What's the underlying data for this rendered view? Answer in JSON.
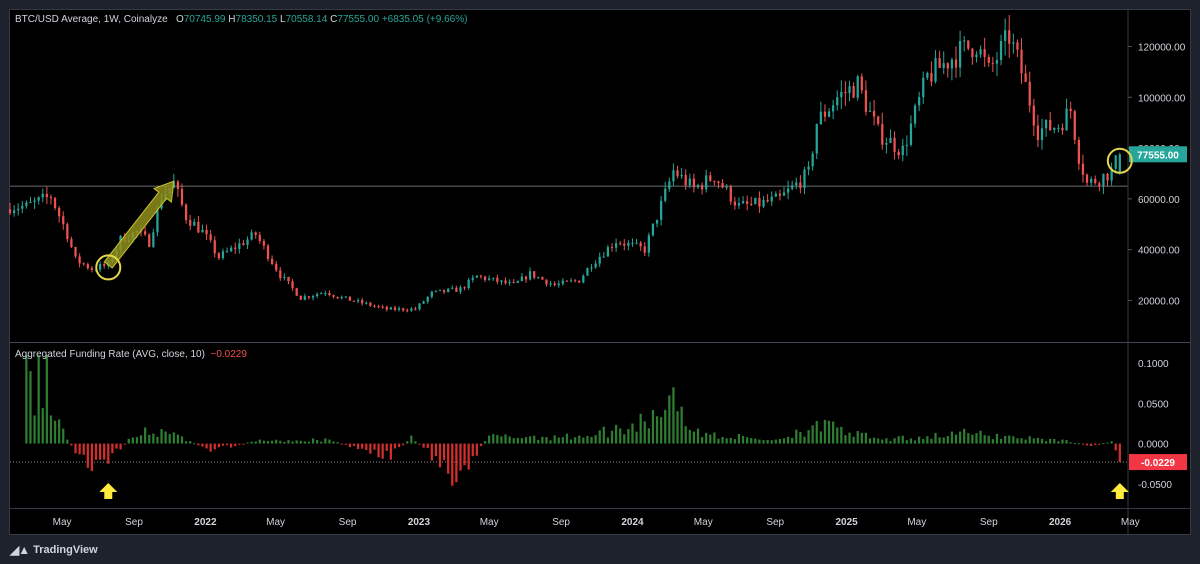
{
  "header": {
    "symbol": "BTC/USD Average, 1W, Coinalyze",
    "o_label": "O",
    "o": "70745.99",
    "h_label": "H",
    "h": "78350.15",
    "l_label": "L",
    "l": "70558.14",
    "c_label": "C",
    "c": "77555.00",
    "change": "+6835.05 (+9.66%)"
  },
  "indicator": {
    "title": "Aggregated Funding Rate (AVG, close, 10)",
    "value": "−0.0229"
  },
  "brand": {
    "name": "TradingView"
  },
  "colors": {
    "up": "#26a69a",
    "down": "#ef5350",
    "fund_up": "#2e7d32",
    "fund_down": "#d32f2f",
    "accent_circle": "#e4d54a",
    "arrow": "#8f8e1c",
    "marker": "#ffeb3b"
  },
  "chart_data": [
    {
      "type": "candlestick",
      "series_name": "BTC/USD Average, 1W, Coinalyze",
      "y_ticks": [
        "120000.00",
        "100000.00",
        "80000.00",
        "60000.00",
        "40000.00",
        "20000.00"
      ],
      "y_tick_values": [
        120000,
        100000,
        80000,
        60000,
        40000,
        20000
      ],
      "ylim": [
        6000,
        132000
      ],
      "last_price_label": "77555.00",
      "last_price": 77555,
      "horizontal_line": 65000,
      "x_ticks": [
        "May",
        "Sep",
        "2022",
        "May",
        "Sep",
        "2023",
        "May",
        "Sep",
        "2024",
        "May",
        "Sep",
        "2025",
        "May",
        "Sep",
        "2026",
        "May"
      ],
      "x_tick_dates": [
        "2021-05-01",
        "2021-09-01",
        "2022-01-01",
        "2022-05-01",
        "2022-09-01",
        "2023-01-01",
        "2023-05-01",
        "2023-09-01",
        "2024-01-01",
        "2024-05-01",
        "2024-09-01",
        "2025-01-01",
        "2025-05-01",
        "2025-09-01",
        "2026-01-01",
        "2026-05-01"
      ],
      "date_range": [
        "2021-03-01",
        "2026-04-13"
      ],
      "closes": [
        [
          "2021-03-01",
          57000
        ],
        [
          "2021-04-12",
          61000
        ],
        [
          "2021-05-10",
          46000
        ],
        [
          "2021-05-24",
          36000
        ],
        [
          "2021-06-21",
          32500
        ],
        [
          "2021-07-19",
          34000
        ],
        [
          "2021-08-09",
          44000
        ],
        [
          "2021-09-06",
          47000
        ],
        [
          "2021-09-27",
          43000
        ],
        [
          "2021-10-18",
          61000
        ],
        [
          "2021-11-08",
          66000
        ],
        [
          "2021-11-29",
          53000
        ],
        [
          "2021-12-27",
          47000
        ],
        [
          "2022-01-24",
          37000
        ],
        [
          "2022-03-28",
          46000
        ],
        [
          "2022-05-09",
          30000
        ],
        [
          "2022-06-13",
          21000
        ],
        [
          "2022-07-25",
          23500
        ],
        [
          "2022-08-15",
          21500
        ],
        [
          "2022-09-12",
          19800
        ],
        [
          "2022-11-07",
          16500
        ],
        [
          "2022-12-26",
          16600
        ],
        [
          "2023-01-23",
          22800
        ],
        [
          "2023-03-13",
          24500
        ],
        [
          "2023-04-10",
          29500
        ],
        [
          "2023-06-12",
          26000
        ],
        [
          "2023-07-10",
          30500
        ],
        [
          "2023-08-21",
          26000
        ],
        [
          "2023-10-02",
          28000
        ],
        [
          "2023-10-23",
          34500
        ],
        [
          "2023-12-04",
          43500
        ],
        [
          "2024-01-22",
          40000
        ],
        [
          "2024-02-26",
          62000
        ],
        [
          "2024-03-11",
          71000
        ],
        [
          "2024-04-15",
          64000
        ],
        [
          "2024-05-20",
          69000
        ],
        [
          "2024-07-01",
          57000
        ],
        [
          "2024-08-05",
          58000
        ],
        [
          "2024-09-09",
          60000
        ],
        [
          "2024-10-28",
          70000
        ],
        [
          "2024-11-11",
          90000
        ],
        [
          "2024-12-16",
          100000
        ],
        [
          "2025-01-20",
          105000
        ],
        [
          "2025-02-24",
          86000
        ],
        [
          "2025-04-07",
          79000
        ],
        [
          "2025-05-19",
          108000
        ],
        [
          "2025-07-14",
          118000
        ],
        [
          "2025-08-11",
          121000
        ],
        [
          "2025-09-01",
          110000
        ],
        [
          "2025-10-06",
          124000
        ],
        [
          "2025-10-27",
          110000
        ],
        [
          "2025-11-24",
          87000
        ],
        [
          "2025-12-29",
          89000
        ],
        [
          "2026-01-19",
          95000
        ],
        [
          "2026-02-02",
          77000
        ],
        [
          "2026-02-16",
          66000
        ],
        [
          "2026-03-09",
          68000
        ],
        [
          "2026-03-30",
          70700
        ],
        [
          "2026-04-13",
          77555
        ]
      ],
      "annotation": {
        "from_date": "2021-07-19",
        "from_price": 34000,
        "to_date": "2021-11-08",
        "to_price": 67000
      },
      "circles": [
        {
          "date": "2021-07-19",
          "price": 33000
        },
        {
          "date": "2026-04-13",
          "price": 75000
        }
      ]
    },
    {
      "type": "bar",
      "series_name": "Aggregated Funding Rate (AVG, close, 10)",
      "y_ticks": [
        "0.1000",
        "0.0500",
        "0.0000",
        "-0.0500"
      ],
      "y_tick_values": [
        0.1,
        0.05,
        0,
        -0.05
      ],
      "ylim": [
        -0.07,
        0.11
      ],
      "last_value_label": "-0.0229",
      "last_value": -0.0229,
      "values_anchor": [
        [
          "2021-03-01",
          0.11
        ],
        [
          "2021-03-08",
          0.09
        ],
        [
          "2021-03-15",
          0.035
        ],
        [
          "2021-03-22",
          0.11
        ],
        [
          "2021-04-05",
          0.11
        ],
        [
          "2021-04-12",
          0.035
        ],
        [
          "2021-04-26",
          0.03
        ],
        [
          "2021-05-10",
          0.005
        ],
        [
          "2021-05-24",
          -0.012
        ],
        [
          "2021-06-14",
          -0.03
        ],
        [
          "2021-07-05",
          -0.02
        ],
        [
          "2021-07-19",
          -0.025
        ],
        [
          "2021-08-23",
          0.006
        ],
        [
          "2021-09-20",
          0.02
        ],
        [
          "2021-10-25",
          0.015
        ],
        [
          "2021-11-22",
          0.009
        ],
        [
          "2022-01-10",
          -0.01
        ],
        [
          "2022-04-04",
          0.005
        ],
        [
          "2022-08-01",
          0.005
        ],
        [
          "2022-11-14",
          -0.02
        ],
        [
          "2022-12-19",
          0.01
        ],
        [
          "2023-03-06",
          -0.048
        ],
        [
          "2023-05-01",
          0.01
        ],
        [
          "2023-10-02",
          0.01
        ],
        [
          "2024-01-01",
          0.025
        ],
        [
          "2024-03-04",
          0.06
        ],
        [
          "2024-03-11",
          0.07
        ],
        [
          "2024-04-15",
          0.015
        ],
        [
          "2024-09-02",
          0.005
        ],
        [
          "2024-11-11",
          0.028
        ],
        [
          "2024-12-16",
          0.02
        ],
        [
          "2025-03-03",
          0.005
        ],
        [
          "2025-07-14",
          0.015
        ],
        [
          "2025-10-06",
          0.01
        ],
        [
          "2026-01-05",
          0.005
        ],
        [
          "2026-02-23",
          -0.003
        ],
        [
          "2026-03-30",
          0.003
        ],
        [
          "2026-04-13",
          -0.0229
        ]
      ],
      "markers": [
        {
          "date": "2021-07-19",
          "shape": "up-arrow"
        },
        {
          "date": "2026-04-13",
          "shape": "up-arrow"
        }
      ]
    }
  ]
}
